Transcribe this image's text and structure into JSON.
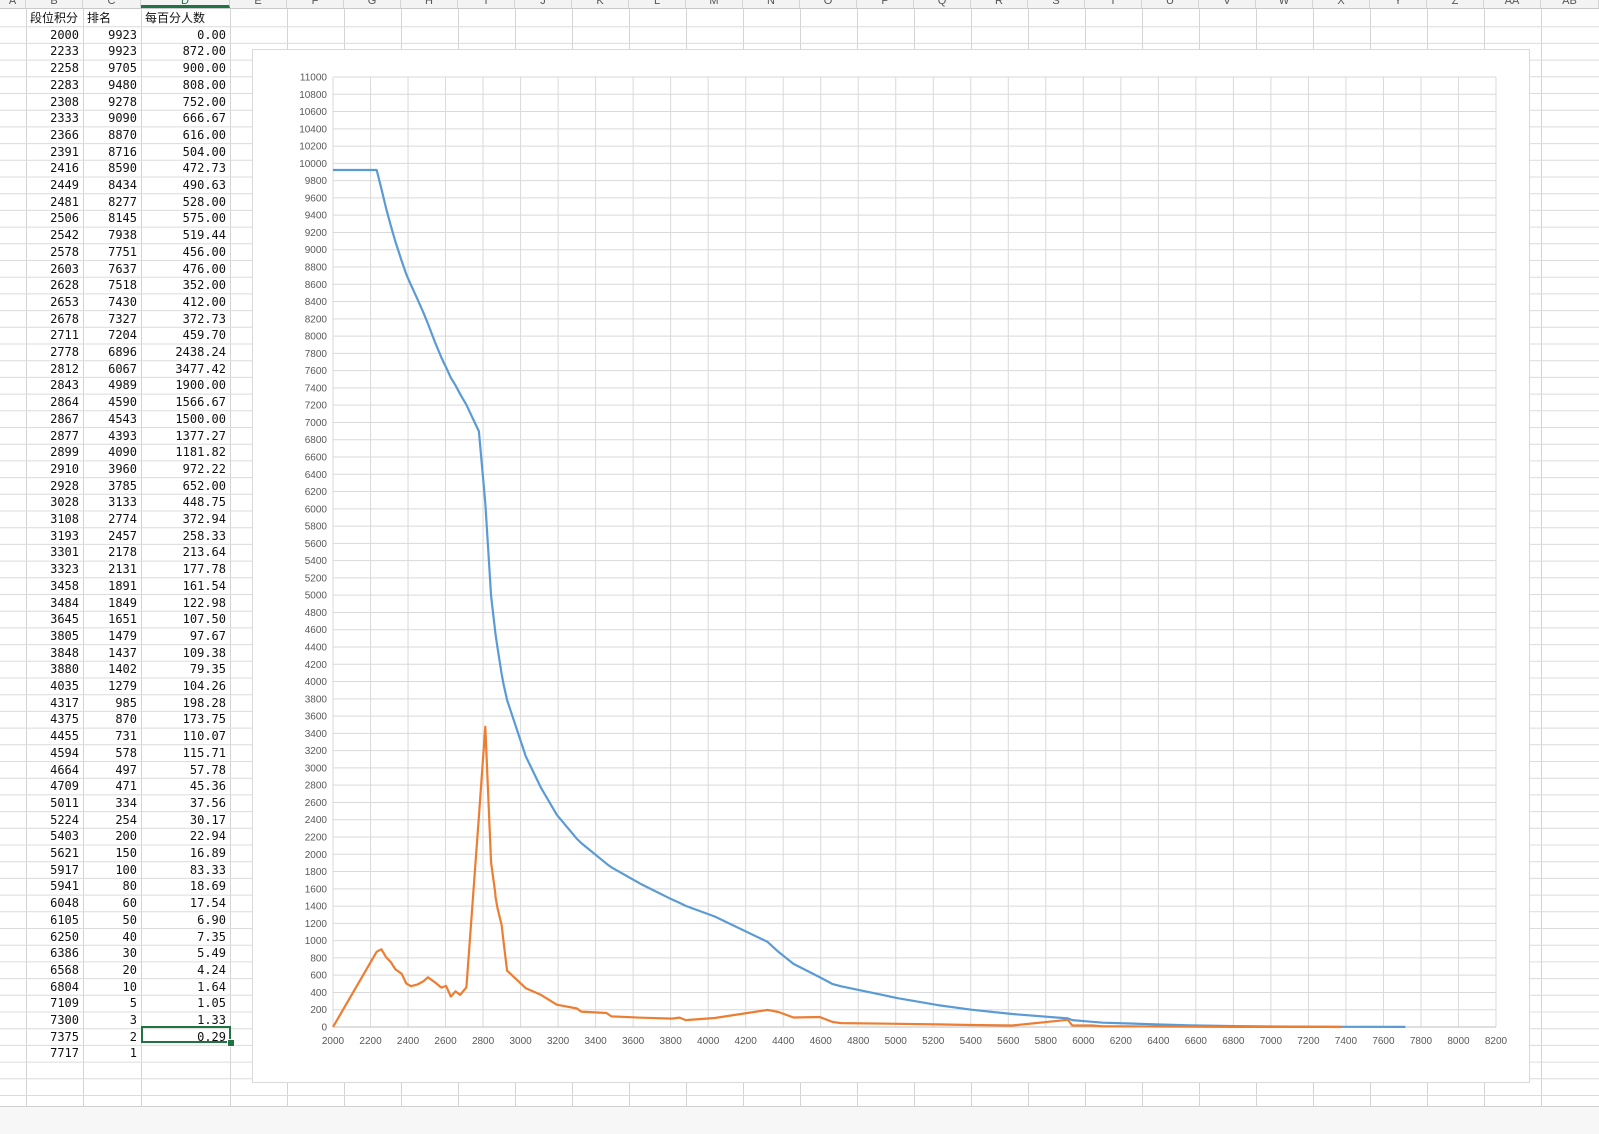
{
  "sheet": {
    "column_letters": [
      "A",
      "B",
      "C",
      "D",
      "E",
      "F",
      "G",
      "H",
      "I",
      "J",
      "K",
      "L",
      "M",
      "N",
      "O",
      "P",
      "Q",
      "R",
      "S",
      "T",
      "U",
      "V",
      "W",
      "X",
      "Y",
      "Z",
      "AA",
      "AB"
    ],
    "active_column": "D",
    "headers": [
      "段位积分",
      "排名",
      "每百分人数"
    ],
    "rows": [
      [
        "2000",
        "9923",
        "0.00"
      ],
      [
        "2233",
        "9923",
        "872.00"
      ],
      [
        "2258",
        "9705",
        "900.00"
      ],
      [
        "2283",
        "9480",
        "808.00"
      ],
      [
        "2308",
        "9278",
        "752.00"
      ],
      [
        "2333",
        "9090",
        "666.67"
      ],
      [
        "2366",
        "8870",
        "616.00"
      ],
      [
        "2391",
        "8716",
        "504.00"
      ],
      [
        "2416",
        "8590",
        "472.73"
      ],
      [
        "2449",
        "8434",
        "490.63"
      ],
      [
        "2481",
        "8277",
        "528.00"
      ],
      [
        "2506",
        "8145",
        "575.00"
      ],
      [
        "2542",
        "7938",
        "519.44"
      ],
      [
        "2578",
        "7751",
        "456.00"
      ],
      [
        "2603",
        "7637",
        "476.00"
      ],
      [
        "2628",
        "7518",
        "352.00"
      ],
      [
        "2653",
        "7430",
        "412.00"
      ],
      [
        "2678",
        "7327",
        "372.73"
      ],
      [
        "2711",
        "7204",
        "459.70"
      ],
      [
        "2778",
        "6896",
        "2438.24"
      ],
      [
        "2812",
        "6067",
        "3477.42"
      ],
      [
        "2843",
        "4989",
        "1900.00"
      ],
      [
        "2864",
        "4590",
        "1566.67"
      ],
      [
        "2867",
        "4543",
        "1500.00"
      ],
      [
        "2877",
        "4393",
        "1377.27"
      ],
      [
        "2899",
        "4090",
        "1181.82"
      ],
      [
        "2910",
        "3960",
        "972.22"
      ],
      [
        "2928",
        "3785",
        "652.00"
      ],
      [
        "3028",
        "3133",
        "448.75"
      ],
      [
        "3108",
        "2774",
        "372.94"
      ],
      [
        "3193",
        "2457",
        "258.33"
      ],
      [
        "3301",
        "2178",
        "213.64"
      ],
      [
        "3323",
        "2131",
        "177.78"
      ],
      [
        "3458",
        "1891",
        "161.54"
      ],
      [
        "3484",
        "1849",
        "122.98"
      ],
      [
        "3645",
        "1651",
        "107.50"
      ],
      [
        "3805",
        "1479",
        "97.67"
      ],
      [
        "3848",
        "1437",
        "109.38"
      ],
      [
        "3880",
        "1402",
        "79.35"
      ],
      [
        "4035",
        "1279",
        "104.26"
      ],
      [
        "4317",
        "985",
        "198.28"
      ],
      [
        "4375",
        "870",
        "173.75"
      ],
      [
        "4455",
        "731",
        "110.07"
      ],
      [
        "4594",
        "578",
        "115.71"
      ],
      [
        "4664",
        "497",
        "57.78"
      ],
      [
        "4709",
        "471",
        "45.36"
      ],
      [
        "5011",
        "334",
        "37.56"
      ],
      [
        "5224",
        "254",
        "30.17"
      ],
      [
        "5403",
        "200",
        "22.94"
      ],
      [
        "5621",
        "150",
        "16.89"
      ],
      [
        "5917",
        "100",
        "83.33"
      ],
      [
        "5941",
        "80",
        "18.69"
      ],
      [
        "6048",
        "60",
        "17.54"
      ],
      [
        "6105",
        "50",
        "6.90"
      ],
      [
        "6250",
        "40",
        "7.35"
      ],
      [
        "6386",
        "30",
        "5.49"
      ],
      [
        "6568",
        "20",
        "4.24"
      ],
      [
        "6804",
        "10",
        "1.64"
      ],
      [
        "7109",
        "5",
        "1.05"
      ],
      [
        "7300",
        "3",
        "1.33"
      ],
      [
        "7375",
        "2",
        "0.29"
      ],
      [
        "7717",
        "1",
        ""
      ]
    ],
    "selected_cell_value": "0.29"
  },
  "chart_data": {
    "type": "line",
    "title": "",
    "xlabel": "",
    "ylabel": "",
    "xlim": [
      2000,
      8200
    ],
    "ylim": [
      0,
      11000
    ],
    "x_ticks": [
      "2000",
      "2200",
      "2400",
      "2600",
      "2800",
      "3000",
      "3200",
      "3400",
      "3600",
      "3800",
      "4000",
      "4200",
      "4400",
      "4600",
      "4800",
      "5000",
      "5200",
      "5400",
      "5600",
      "5800",
      "6000",
      "6200",
      "6400",
      "6600",
      "6800",
      "7000",
      "7200",
      "7400",
      "7600",
      "7800",
      "8000",
      "8200"
    ],
    "y_ticks": [
      "0",
      "200",
      "400",
      "600",
      "800",
      "1000",
      "1200",
      "1400",
      "1600",
      "1800",
      "2000",
      "2200",
      "2400",
      "2600",
      "2800",
      "3000",
      "3200",
      "3400",
      "3600",
      "3800",
      "4000",
      "4200",
      "4400",
      "4600",
      "4800",
      "5000",
      "5200",
      "5400",
      "5600",
      "5800",
      "6000",
      "6200",
      "6400",
      "6600",
      "6800",
      "7000",
      "7200",
      "7400",
      "7600",
      "7800",
      "8000",
      "8200",
      "8400",
      "8600",
      "8800",
      "9000",
      "9200",
      "9400",
      "9600",
      "9800",
      "10000",
      "10200",
      "10400",
      "10600",
      "10800",
      "11000"
    ],
    "grid": true,
    "series": [
      {
        "color": "#5b9bd5",
        "source_column": "排名"
      },
      {
        "color": "#ed7d31",
        "source_column": "每百分人数"
      }
    ]
  }
}
